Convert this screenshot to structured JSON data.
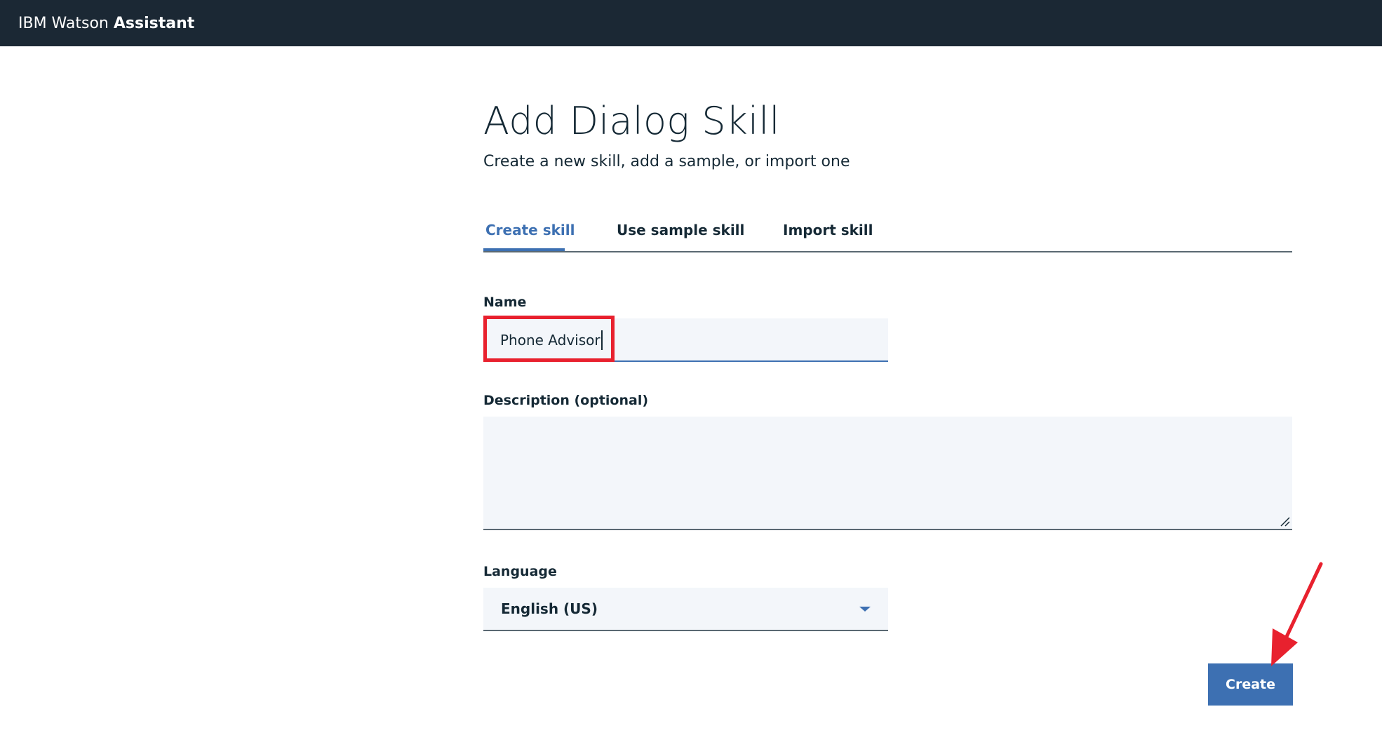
{
  "app": {
    "brand_light": "IBM Watson",
    "brand_bold": "Assistant"
  },
  "page": {
    "title": "Add Dialog Skill",
    "subtitle": "Create a new skill, add a sample, or import one"
  },
  "tabs": [
    {
      "label": "Create skill",
      "active": true
    },
    {
      "label": "Use sample skill",
      "active": false
    },
    {
      "label": "Import skill",
      "active": false
    }
  ],
  "form": {
    "name_label": "Name",
    "name_value": "Phone Advisor",
    "description_label": "Description (optional)",
    "description_value": "",
    "language_label": "Language",
    "language_value": "English (US)"
  },
  "actions": {
    "create_label": "Create"
  },
  "colors": {
    "header_bg": "#1b2834",
    "accent": "#3d70b2",
    "input_bg": "#f3f6fa",
    "annotation": "#e8212e"
  },
  "icons": {
    "dropdown": "chevron-down-icon",
    "resize": "resize-handle-icon",
    "annotation": "red-arrow-icon"
  }
}
